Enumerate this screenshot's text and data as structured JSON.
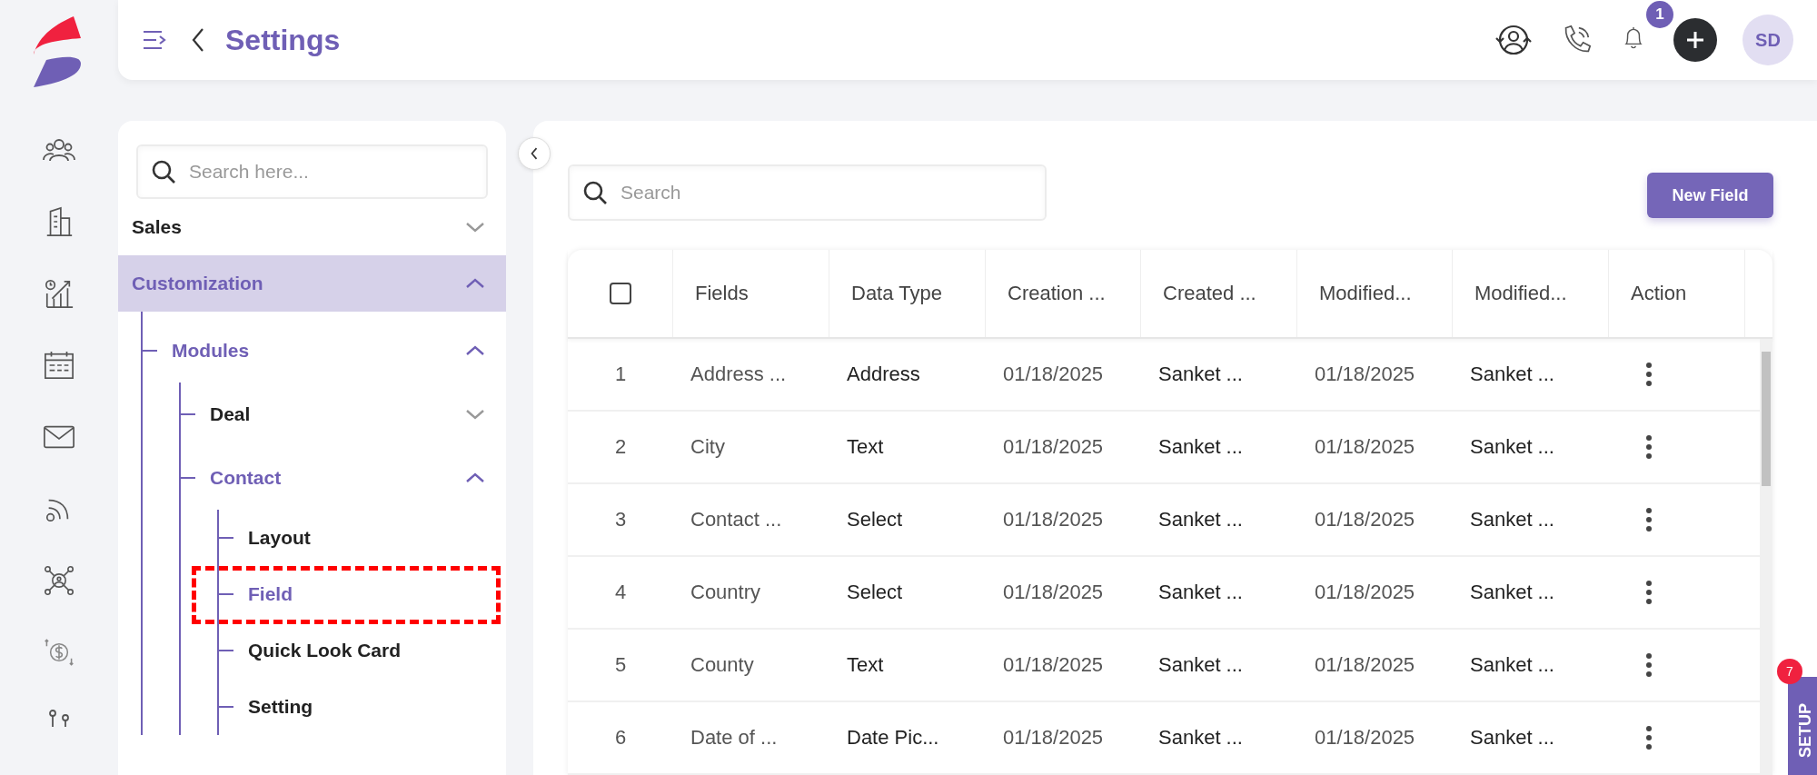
{
  "header": {
    "title": "Settings",
    "notifications": "1",
    "avatar": "SD"
  },
  "nav_search": {
    "placeholder": "Search here..."
  },
  "nav_tree": [
    {
      "label": "Sales",
      "expanded": false,
      "selected": false
    },
    {
      "label": "Customization",
      "expanded": true,
      "selected": true,
      "children": [
        {
          "label": "Modules",
          "expanded": true,
          "selected": true,
          "children": [
            {
              "label": "Deal",
              "expanded": false,
              "selected": false
            },
            {
              "label": "Contact",
              "expanded": true,
              "selected": true,
              "children": [
                {
                  "label": "Layout",
                  "selected": false,
                  "annotated": false
                },
                {
                  "label": "Field",
                  "selected": true,
                  "annotated": true
                },
                {
                  "label": "Quick Look Card",
                  "selected": false,
                  "annotated": false
                },
                {
                  "label": "Setting",
                  "selected": false,
                  "annotated": false
                }
              ]
            }
          ]
        }
      ]
    }
  ],
  "search": {
    "placeholder": "Search"
  },
  "new_button": "New Field",
  "table": {
    "select_all_checked": false,
    "columns": [
      "Fields",
      "Data Type",
      "Creation ...",
      "Created ...",
      "Modified...",
      "Modified...",
      "Action"
    ],
    "rows": [
      {
        "index": "1",
        "field": "Address ...",
        "data_type": "Address",
        "created_on": "01/18/2025",
        "created_by": "Sanket ...",
        "modified_on": "01/18/2025",
        "modified_by": "Sanket ..."
      },
      {
        "index": "2",
        "field": "City",
        "data_type": "Text",
        "created_on": "01/18/2025",
        "created_by": "Sanket ...",
        "modified_on": "01/18/2025",
        "modified_by": "Sanket ..."
      },
      {
        "index": "3",
        "field": "Contact ...",
        "data_type": "Select",
        "created_on": "01/18/2025",
        "created_by": "Sanket ...",
        "modified_on": "01/18/2025",
        "modified_by": "Sanket ..."
      },
      {
        "index": "4",
        "field": "Country",
        "data_type": "Select",
        "created_on": "01/18/2025",
        "created_by": "Sanket ...",
        "modified_on": "01/18/2025",
        "modified_by": "Sanket ..."
      },
      {
        "index": "5",
        "field": "County",
        "data_type": "Text",
        "created_on": "01/18/2025",
        "created_by": "Sanket ...",
        "modified_on": "01/18/2025",
        "modified_by": "Sanket ..."
      },
      {
        "index": "6",
        "field": "Date of ...",
        "data_type": "Date Pic...",
        "created_on": "01/18/2025",
        "created_by": "Sanket ...",
        "modified_on": "01/18/2025",
        "modified_by": "Sanket ..."
      }
    ]
  },
  "setup_tab": {
    "label": "SETUP",
    "badge": "7"
  }
}
